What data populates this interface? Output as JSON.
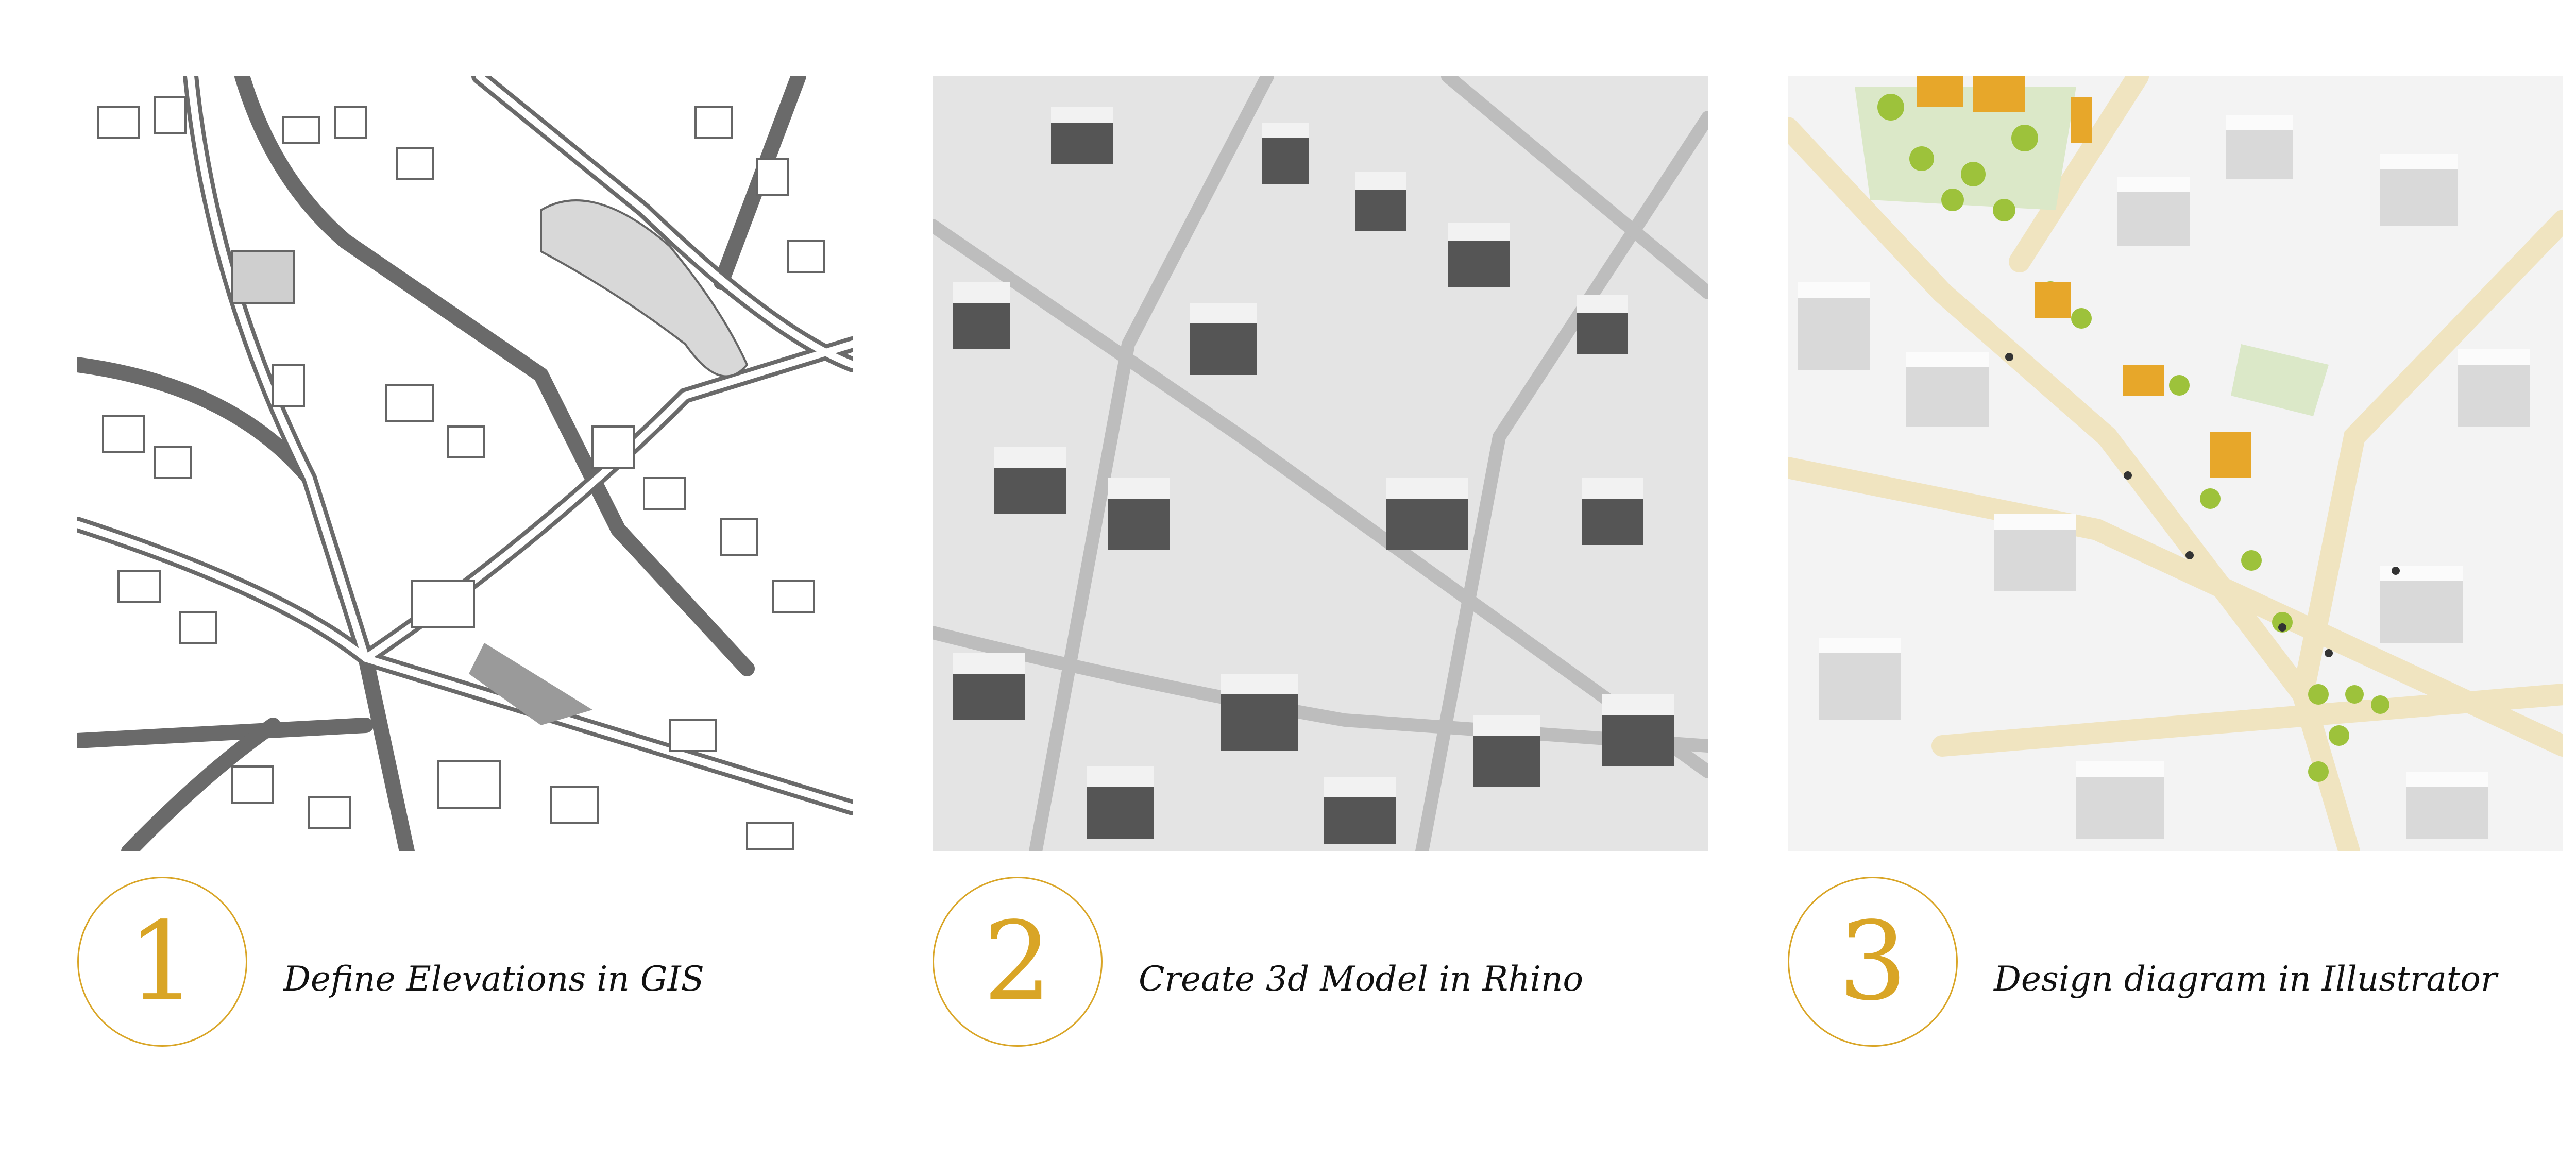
{
  "steps": [
    {
      "number": "1",
      "caption": "Define Elevations in GIS",
      "image": "gis-figure-ground-map"
    },
    {
      "number": "2",
      "caption": "Create 3d Model in Rhino",
      "image": "rhino-3d-massing-model"
    },
    {
      "number": "3",
      "caption": "Design diagram in Illustrator",
      "image": "illustrator-axonometric-diagram"
    }
  ],
  "colors": {
    "accent": "#d9a526",
    "street": "#f0e4c0",
    "tree": "#9dc23b",
    "highlight_building": "#e7a72a"
  }
}
